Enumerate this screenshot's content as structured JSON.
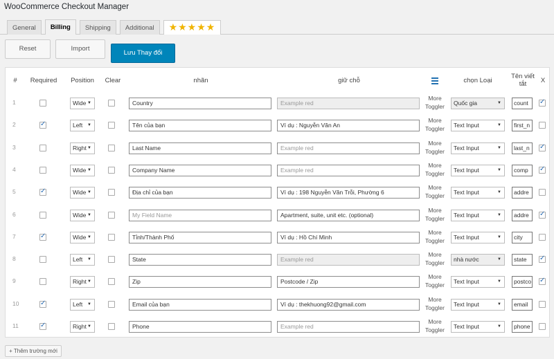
{
  "app_title": "WooCommerce Checkout Manager",
  "tabs": [
    {
      "label": "General",
      "active": false
    },
    {
      "label": "Billing",
      "active": true
    },
    {
      "label": "Shipping",
      "active": false
    },
    {
      "label": "Additional",
      "active": false
    }
  ],
  "stars_label": "★★★★★",
  "buttons": {
    "reset": "Reset",
    "import": "Import",
    "save": "Lưu Thay đổi",
    "add_field": "+ Thêm trường mới"
  },
  "table": {
    "headers": {
      "num": "#",
      "required": "Required",
      "position": "Position",
      "clear": "Clear",
      "label": "nhãn",
      "placeholder": "giữ chỗ",
      "type": "chọn Loại",
      "abbr": "Tên viết tắt",
      "x": "X"
    },
    "toggler_label": "More Toggler",
    "rows": [
      {
        "num": "1",
        "required": false,
        "position": "Wide",
        "clear": false,
        "label": "Country",
        "label_placeholder": false,
        "placeholder": "Example red",
        "ph_muted": true,
        "ph_disabled": true,
        "type": "Quốc gia",
        "type_disabled": true,
        "abbr": "count",
        "x": true
      },
      {
        "num": "2",
        "required": true,
        "position": "Left",
        "clear": false,
        "label": "Tên của bạn",
        "label_placeholder": false,
        "placeholder": "Ví dụ : Nguyễn Văn An",
        "ph_muted": false,
        "ph_disabled": false,
        "type": "Text Input",
        "type_disabled": false,
        "abbr": "first_n",
        "x": false
      },
      {
        "num": "3",
        "required": false,
        "position": "Right",
        "clear": false,
        "label": "Last Name",
        "label_placeholder": false,
        "placeholder": "Example red",
        "ph_muted": true,
        "ph_disabled": false,
        "type": "Text Input",
        "type_disabled": false,
        "abbr": "last_n",
        "x": true
      },
      {
        "num": "4",
        "required": false,
        "position": "Wide",
        "clear": false,
        "label": "Company Name",
        "label_placeholder": false,
        "placeholder": "Example red",
        "ph_muted": true,
        "ph_disabled": false,
        "type": "Text Input",
        "type_disabled": false,
        "abbr": "comp",
        "x": true
      },
      {
        "num": "5",
        "required": true,
        "position": "Wide",
        "clear": false,
        "label": "Địa chỉ của bạn",
        "label_placeholder": false,
        "placeholder": "Ví dụ : 198 Nguyễn Văn Trỗi, Phường 6",
        "ph_muted": false,
        "ph_disabled": false,
        "type": "Text Input",
        "type_disabled": false,
        "abbr": "addre",
        "x": false
      },
      {
        "num": "6",
        "required": false,
        "position": "Wide",
        "clear": false,
        "label": "My Field Name",
        "label_placeholder": true,
        "placeholder": "Apartment, suite, unit etc. (optional)",
        "ph_muted": false,
        "ph_disabled": false,
        "type": "Text Input",
        "type_disabled": false,
        "abbr": "addre",
        "x": true
      },
      {
        "num": "7",
        "required": true,
        "position": "Wide",
        "clear": false,
        "label": "Tỉnh/Thành Phố",
        "label_placeholder": false,
        "placeholder": "Ví dụ : Hồ Chí Minh",
        "ph_muted": false,
        "ph_disabled": false,
        "type": "Text Input",
        "type_disabled": false,
        "abbr": "city",
        "x": false
      },
      {
        "num": "8",
        "required": false,
        "position": "Left",
        "clear": false,
        "label": "State",
        "label_placeholder": false,
        "placeholder": "Example red",
        "ph_muted": true,
        "ph_disabled": true,
        "type": "nhà nước",
        "type_disabled": true,
        "abbr": "state",
        "x": true
      },
      {
        "num": "9",
        "required": false,
        "position": "Right",
        "clear": false,
        "label": "Zip",
        "label_placeholder": false,
        "placeholder": "Postcode / Zip",
        "ph_muted": false,
        "ph_disabled": false,
        "type": "Text Input",
        "type_disabled": false,
        "abbr": "postco",
        "x": true
      },
      {
        "num": "10",
        "required": true,
        "position": "Left",
        "clear": false,
        "label": "Email của bạn",
        "label_placeholder": false,
        "placeholder": "Ví dụ : thekhuong92@gmail.com",
        "ph_muted": false,
        "ph_disabled": false,
        "type": "Text Input",
        "type_disabled": false,
        "abbr": "email",
        "x": false
      },
      {
        "num": "11",
        "required": true,
        "position": "Right",
        "clear": false,
        "label": "Phone",
        "label_placeholder": false,
        "placeholder": "Example red",
        "ph_muted": true,
        "ph_disabled": false,
        "type": "Text Input",
        "type_disabled": false,
        "abbr": "phone",
        "x": false
      }
    ]
  },
  "icons": {
    "columns_menu": "menu-bars-icon",
    "checkbox_check": "checkmark-icon",
    "dropdown": "chevron-down-icon",
    "rating": "star-icon"
  },
  "colors": {
    "accent": "#0085ba",
    "check": "#2c6eb5",
    "stars": "#f0b400",
    "menu_icon": "#2271b1"
  }
}
